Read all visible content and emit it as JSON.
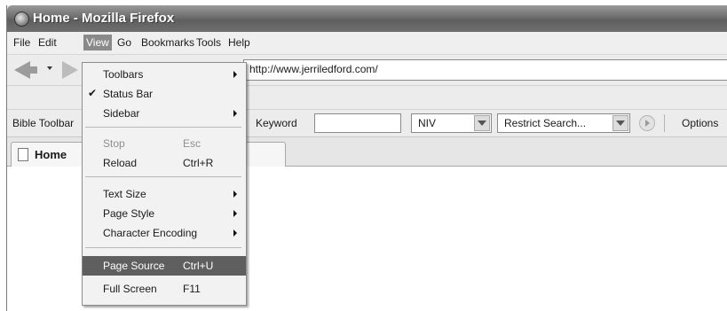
{
  "window": {
    "title": "Home - Mozilla Firefox"
  },
  "menubar": {
    "items": [
      "File",
      "Edit",
      "View",
      "Go",
      "Bookmarks",
      "Tools",
      "Help"
    ],
    "active": "View"
  },
  "navbar": {
    "url": "http://www.jerriledford.com/"
  },
  "bible_toolbar": {
    "label": "Bible Toolbar",
    "keyword_label": "Keyword",
    "keyword_value": "",
    "version_select": "NIV",
    "restrict_select": "Restrict Search...",
    "options_label": "Options"
  },
  "tabs": [
    {
      "label": "Home"
    }
  ],
  "view_menu": {
    "items": [
      {
        "label": "Toolbars",
        "submenu": true
      },
      {
        "label": "Status Bar",
        "checked": true
      },
      {
        "label": "Sidebar",
        "submenu": true
      },
      {
        "label": "Stop",
        "accel": "Esc",
        "disabled": true
      },
      {
        "label": "Reload",
        "accel": "Ctrl+R"
      },
      {
        "label": "Text Size",
        "submenu": true
      },
      {
        "label": "Page Style",
        "submenu": true
      },
      {
        "label": "Character Encoding",
        "submenu": true
      },
      {
        "label": "Page Source",
        "accel": "Ctrl+U",
        "highlighted": true
      },
      {
        "label": "Full Screen",
        "accel": "F11"
      }
    ]
  },
  "icons": {
    "app": "firefox-icon",
    "back": "back-arrow-icon",
    "forward": "forward-arrow-icon",
    "tab_page": "page-icon",
    "go": "go-icon",
    "check": "checkmark-icon",
    "submenu": "submenu-arrow-icon"
  }
}
